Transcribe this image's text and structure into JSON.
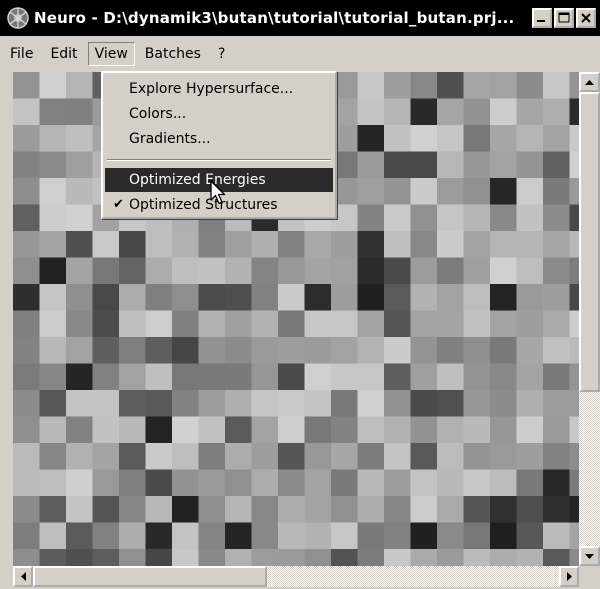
{
  "window": {
    "title": "Neuro - D:\\dynamik3\\butan\\tutorial\\tutorial_butan.prj...",
    "icon": "neuro-app-icon"
  },
  "menubar": [
    "File",
    "Edit",
    "View",
    "Batches",
    "?"
  ],
  "view_menu": {
    "items": [
      {
        "label": "Explore Hypersurface...",
        "checked": false,
        "highlighted": false
      },
      {
        "label": "Colors...",
        "checked": false,
        "highlighted": false
      },
      {
        "label": "Gradients...",
        "checked": false,
        "highlighted": false
      },
      {
        "label": "Optimized Energies",
        "checked": false,
        "highlighted": true
      },
      {
        "label": "Optimized Structures",
        "checked": true,
        "highlighted": false
      }
    ]
  },
  "colors": {
    "title_bg": "#000000",
    "highlight": "#2a2a2a",
    "chrome": "#d4d0c8"
  }
}
